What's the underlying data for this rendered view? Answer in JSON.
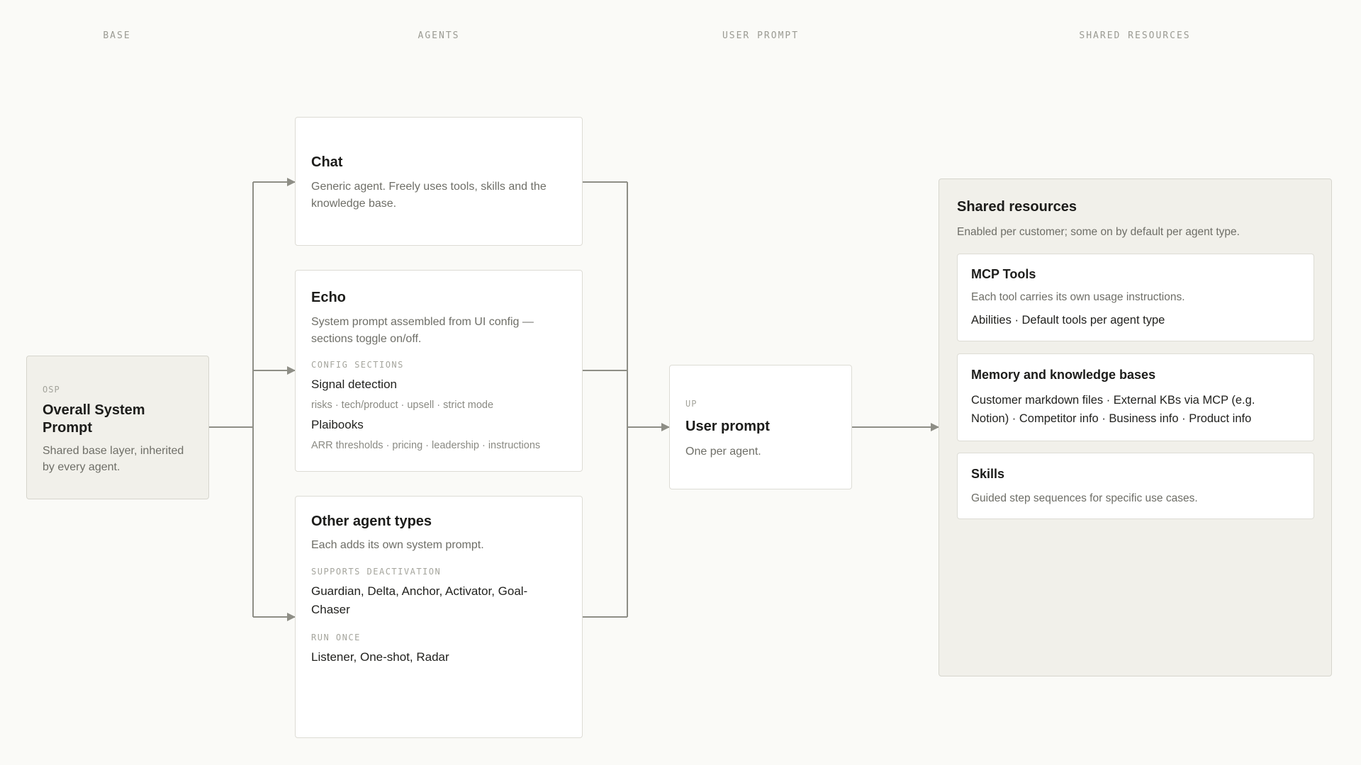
{
  "columns": {
    "base": "BASE",
    "agents": "AGENTS",
    "user_prompt": "USER PROMPT",
    "shared": "SHARED RESOURCES"
  },
  "osp": {
    "tag": "OSP",
    "title": "Overall System Prompt",
    "desc": "Shared base layer, inherited by every agent."
  },
  "chat": {
    "title": "Chat",
    "desc": "Generic agent. Freely uses tools, skills and the knowledge base."
  },
  "echo": {
    "title": "Echo",
    "desc": "System prompt assembled from UI config — sections toggle on/off.",
    "section_label": "CONFIG SECTIONS",
    "signal_title": "Signal detection",
    "signal_sub": "risks · tech/product · upsell · strict mode",
    "plaibooks_title": "Plaibooks",
    "plaibooks_sub": "ARR thresholds · pricing · leadership · instructions"
  },
  "other": {
    "title": "Other agent types",
    "desc": "Each adds its own system prompt.",
    "deact_label": "SUPPORTS DEACTIVATION",
    "deact_items": "Guardian, Delta, Anchor, Activator, Goal-Chaser",
    "once_label": "RUN ONCE",
    "once_items": "Listener, One-shot, Radar"
  },
  "up": {
    "tag": "UP",
    "title": "User prompt",
    "desc": "One per agent."
  },
  "shared": {
    "title": "Shared resources",
    "desc": "Enabled per customer; some on by default per agent type.",
    "mcp_title": "MCP Tools",
    "mcp_desc": "Each tool carries its own usage instructions.",
    "mcp_items": "Abilities · Default tools per agent type",
    "memory_title": "Memory and knowledge bases",
    "memory_items": "Customer markdown files · External KBs via MCP (e.g. Notion) · Competitor info · Business info · Product info",
    "skills_title": "Skills",
    "skills_desc": "Guided step sequences for specific use cases."
  },
  "colors": {
    "connector": "#8e8e86",
    "background": "#fafaf7",
    "tinted_panel": "#f1f0ea"
  }
}
